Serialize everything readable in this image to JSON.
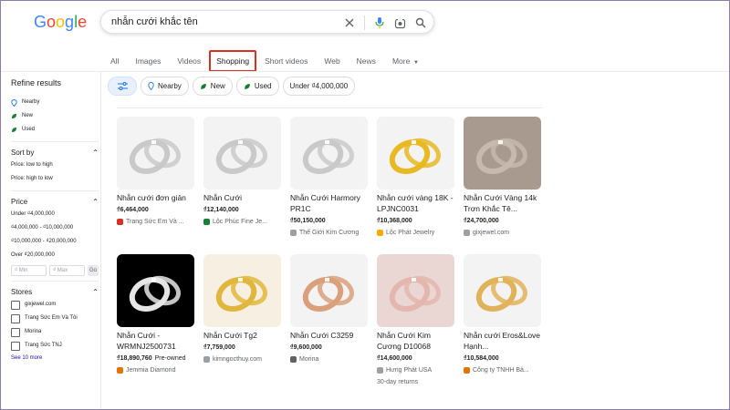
{
  "header": {
    "logo": "Google",
    "search_query": "nhẫn cưới khắc tên"
  },
  "tabs": [
    {
      "label": "All"
    },
    {
      "label": "Images"
    },
    {
      "label": "Videos"
    },
    {
      "label": "Shopping",
      "active": true
    },
    {
      "label": "Short videos"
    },
    {
      "label": "Web"
    },
    {
      "label": "News"
    },
    {
      "label": "More"
    }
  ],
  "chips": {
    "nearby": "Nearby",
    "new": "New",
    "used": "Used",
    "under": "Under ₫4,000,000"
  },
  "sidebar": {
    "title": "Refine results",
    "availability": [
      "Nearby",
      "New",
      "Used"
    ],
    "sort_by": {
      "title": "Sort by",
      "items": [
        "Price: low to high",
        "Price: high to low"
      ]
    },
    "price": {
      "title": "Price",
      "items": [
        "Under ₫4,000,000",
        "₫4,000,000 - ₫10,000,000",
        "₫10,000,000 - ₫20,000,000",
        "Over ₫20,000,000"
      ],
      "min_placeholder": "₫ Min",
      "max_placeholder": "₫ Max",
      "go": "Go"
    },
    "stores": {
      "title": "Stores",
      "items": [
        "gixjewel.com",
        "Trang Sức Em Và Tôi",
        "Morina",
        "Trang Sức TNJ"
      ],
      "see_more": "See 10 more"
    }
  },
  "products": [
    {
      "title": "Nhẫn cưới đơn giản",
      "price": "₫6,464,000",
      "extra": "",
      "store": "Trang Sức Em Và ...",
      "note": "",
      "store_color": "#d93025",
      "ring_color": "#c9c9c9"
    },
    {
      "title": "Nhẫn Cưới",
      "price": "₫12,140,000",
      "extra": "",
      "store": "Lộc Phúc Fine Je...",
      "note": "",
      "store_color": "#188038",
      "ring_color": "#c9c9c9"
    },
    {
      "title": "Nhẫn Cưới Harmory PR1C",
      "price": "₫50,150,000",
      "extra": "",
      "store": "Thế Giới Kim Cương",
      "note": "",
      "store_color": "#9aa0a6",
      "ring_color": "#c9c9c9"
    },
    {
      "title": "Nhẫn cưới vàng 18K - LPJNC0031",
      "price": "₫10,368,000",
      "extra": "",
      "store": "Lộc Phát Jewelry",
      "note": "",
      "store_color": "#f9ab00",
      "ring_color": "#e8b923"
    },
    {
      "title": "Nhẫn Cưới Vàng 14k Trơn Khắc Tê...",
      "price": "₫24,700,000",
      "extra": "",
      "store": "gixjewel.com",
      "note": "",
      "store_color": "#9aa0a6",
      "ring_color": "#c7b9ad"
    },
    {
      "title": "Nhẫn Cưới - WRMNJ2500731",
      "price": "₫18,890,760",
      "extra": "Pre-owned",
      "store": "Jemmia Diamond",
      "note": "",
      "store_color": "#e37400",
      "ring_color": "#e6e6e6"
    },
    {
      "title": "Nhẫn Cưới Tg2",
      "price": "₫7,759,000",
      "extra": "",
      "store": "kimngocthuy.com",
      "note": "",
      "store_color": "#9aa0a6",
      "ring_color": "#e0b73c"
    },
    {
      "title": "Nhẫn Cưới C3259",
      "price": "₫9,600,000",
      "extra": "",
      "store": "Morina",
      "note": "",
      "store_color": "#5f6368",
      "ring_color": "#d9a07b"
    },
    {
      "title": "Nhẫn Cưới Kim Cương D10068",
      "price": "₫14,600,000",
      "extra": "",
      "store": "Hưng Phát USA",
      "note": "30-day returns",
      "store_color": "#9aa0a6",
      "ring_color": "#e3b7ad"
    },
    {
      "title": "Nhẫn cưới Eros&Love Hạnh...",
      "price": "₫10,584,000",
      "extra": "",
      "store": "Công ty TNHH Bả...",
      "note": "",
      "store_color": "#e37400",
      "ring_color": "#e0b35a"
    }
  ]
}
